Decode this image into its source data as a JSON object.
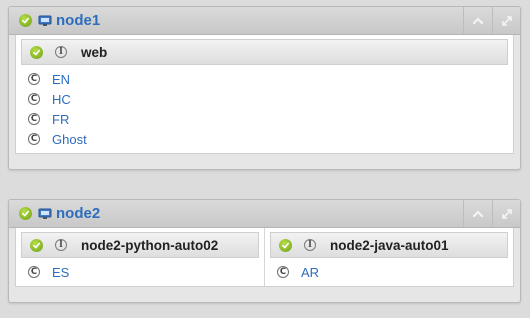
{
  "nodes": [
    {
      "name": "node1",
      "apps": [
        {
          "name": "web",
          "services": [
            "EN",
            "HC",
            "FR",
            "Ghost"
          ]
        }
      ]
    },
    {
      "name": "node2",
      "apps": [
        {
          "name": "node2-python-auto02",
          "services": [
            "ES"
          ]
        },
        {
          "name": "node2-java-auto01",
          "services": [
            "AR"
          ]
        }
      ]
    }
  ],
  "icons": {
    "status": "check-circle-icon",
    "node": "monitor-icon",
    "app": "info-icon",
    "service": "copyright-c-icon",
    "collapse": "chevron-up-icon",
    "expand": "expand-arrows-icon"
  },
  "colors": {
    "link": "#2d6dbd",
    "status_ok": "#7bb31a",
    "header_bg": "#d0d0d0"
  }
}
